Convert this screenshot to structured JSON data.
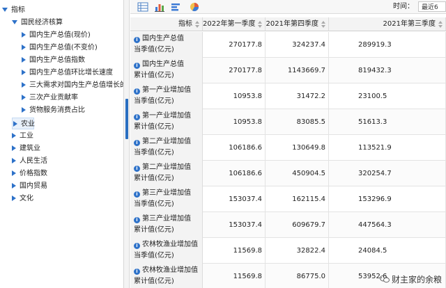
{
  "tree": {
    "root": "指标",
    "group": "国民经济核算",
    "children": [
      "国内生产总值(现价)",
      "国内生产总值(不变价)",
      "国内生产总值指数",
      "国内生产总值环比增长速度",
      "三大需求对国内生产总值增长的贡",
      "三次产业贡献率",
      "货物服务消费占比"
    ],
    "others": [
      "农业",
      "工业",
      "建筑业",
      "人民生活",
      "价格指数",
      "国内贸易",
      "文化"
    ]
  },
  "toolbar": {
    "icons": [
      "table-icon",
      "bar-chart-icon",
      "horizontal-bar-icon",
      "pie-chart-icon"
    ],
    "time_label": "时间：",
    "time_value": "最近6"
  },
  "table": {
    "headers": [
      "指标",
      "2022年第一季度",
      "2021年第四季度",
      "2021年第三季度"
    ],
    "rows": [
      {
        "name1": "国内生产总值",
        "name2": "当季值(亿元)",
        "values": [
          "270177.8",
          "324237.4",
          "289919.3"
        ]
      },
      {
        "name1": "国内生产总值",
        "name2": "累计值(亿元)",
        "values": [
          "270177.8",
          "1143669.7",
          "819432.3"
        ]
      },
      {
        "name1": "第一产业增加值",
        "name2": "当季值(亿元)",
        "values": [
          "10953.8",
          "31472.2",
          "23100.5"
        ]
      },
      {
        "name1": "第一产业增加值",
        "name2": "累计值(亿元)",
        "values": [
          "10953.8",
          "83085.5",
          "51613.3"
        ]
      },
      {
        "name1": "第二产业增加值",
        "name2": "当季值(亿元)",
        "values": [
          "106186.6",
          "130649.8",
          "113521.9"
        ]
      },
      {
        "name1": "第二产业增加值",
        "name2": "累计值(亿元)",
        "values": [
          "106186.6",
          "450904.5",
          "320254.7"
        ]
      },
      {
        "name1": "第三产业增加值",
        "name2": "当季值(亿元)",
        "values": [
          "153037.4",
          "162115.4",
          "153296.9"
        ]
      },
      {
        "name1": "第三产业增加值",
        "name2": "累计值(亿元)",
        "values": [
          "153037.4",
          "609679.7",
          "447564.3"
        ]
      },
      {
        "name1": "农林牧渔业增加值",
        "name2": "当季值(亿元)",
        "values": [
          "11569.8",
          "32822.4",
          "24084.5"
        ]
      },
      {
        "name1": "农林牧渔业增加值",
        "name2": "累计值(亿元)",
        "values": [
          "11569.8",
          "86775.0",
          "53952.6"
        ]
      }
    ]
  },
  "watermark": "财主家的余粮",
  "colors": {
    "accent": "#2e72c9",
    "header_bg": "#f3f3f3"
  }
}
